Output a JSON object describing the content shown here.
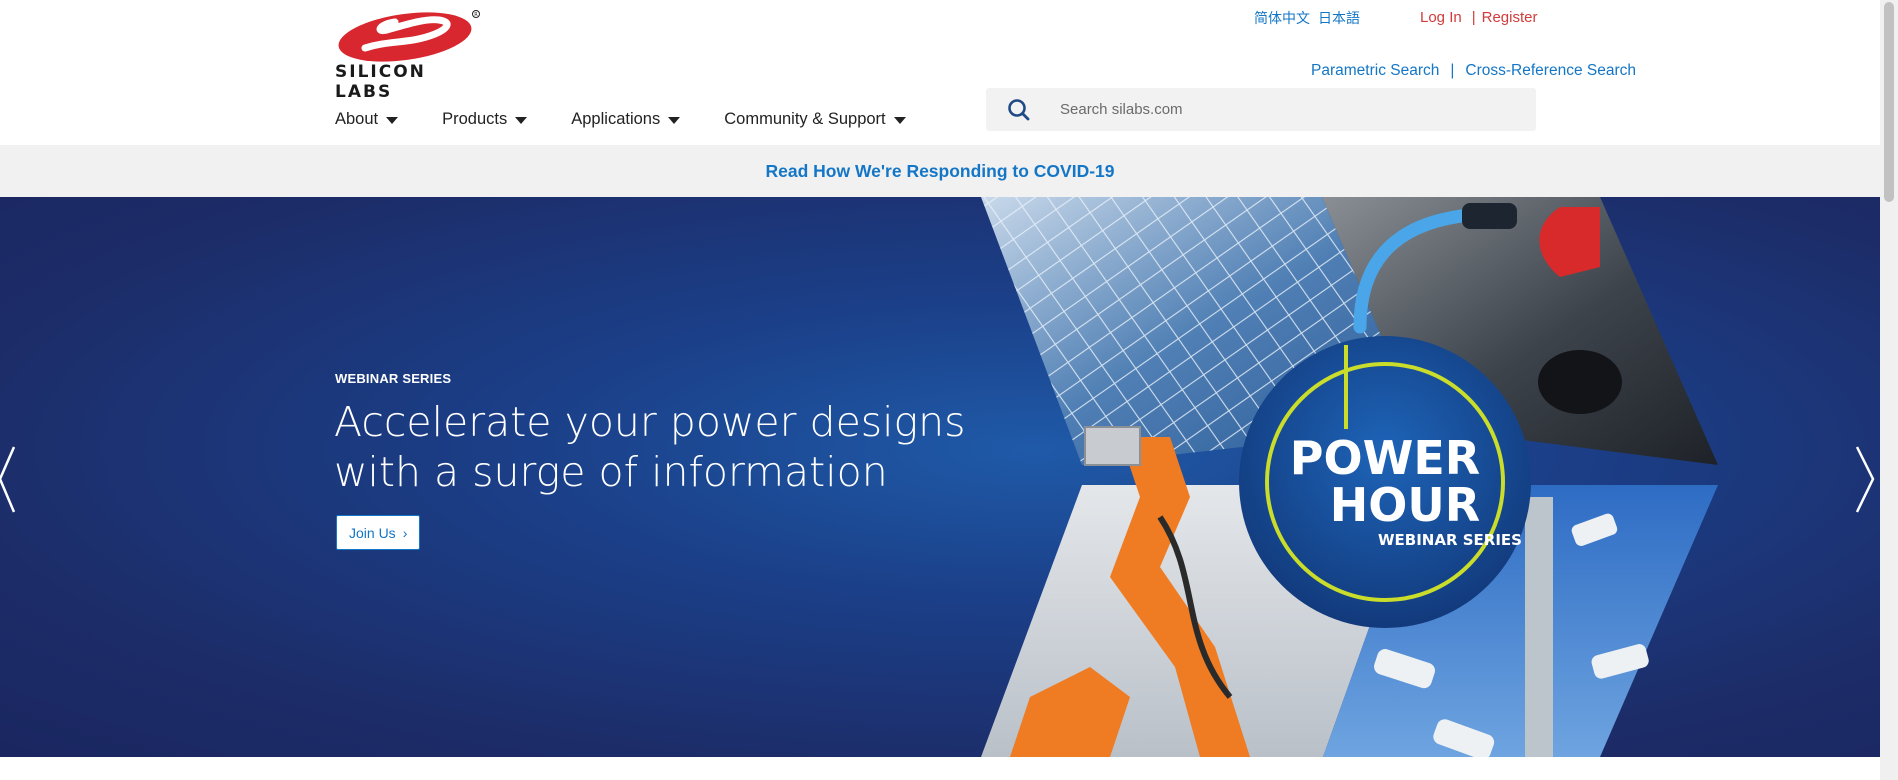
{
  "brand": {
    "logo_text": "SILICON LABS",
    "registered_mark": "®",
    "primary_color": "#d8272f",
    "link_color": "#1476c6"
  },
  "languages": [
    {
      "label": "简体中文"
    },
    {
      "label": "日本語"
    }
  ],
  "auth": {
    "login": "Log In",
    "separator": "|",
    "register": "Register"
  },
  "tools": {
    "parametric": "Parametric Search",
    "separator": "|",
    "cross_reference": "Cross-Reference Search"
  },
  "nav": [
    {
      "label": "About"
    },
    {
      "label": "Products"
    },
    {
      "label": "Applications"
    },
    {
      "label": "Community & Support"
    }
  ],
  "search": {
    "placeholder": "Search silabs.com",
    "value": ""
  },
  "covid_banner": {
    "label": "Read How We're Responding to COVID-19"
  },
  "hero": {
    "eyebrow": "WEBINAR SERIES",
    "headline": "Accelerate your power designs with a surge of information",
    "cta": "Join Us",
    "cta_icon": "chevron-right-icon",
    "badge": {
      "line1": "POWER",
      "line2": "HOUR",
      "line3": "WEBINAR SERIES"
    },
    "background_color": "#1b3f88"
  }
}
